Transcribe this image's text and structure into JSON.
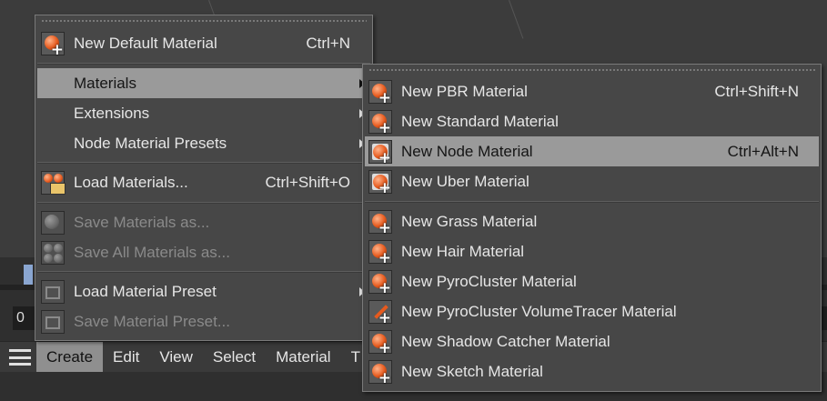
{
  "timeline": {
    "frame_value": "0"
  },
  "menubar": {
    "items": [
      {
        "label": "Create",
        "active": true
      },
      {
        "label": "Edit"
      },
      {
        "label": "View"
      },
      {
        "label": "Select"
      },
      {
        "label": "Material"
      },
      {
        "label": "T"
      }
    ]
  },
  "create_menu": {
    "items": [
      {
        "label": "New Default Material",
        "shortcut": "Ctrl+N",
        "icon": "new-material-icon"
      },
      {
        "label": "Materials",
        "submenu": true,
        "highlight": true
      },
      {
        "label": "Extensions",
        "submenu": true
      },
      {
        "label": "Node Material Presets",
        "submenu": true
      },
      {
        "label": "Load Materials...",
        "shortcut": "Ctrl+Shift+O",
        "icon": "load-materials-icon"
      },
      {
        "label": "Save Materials as...",
        "disabled": true,
        "icon": "save-materials-icon"
      },
      {
        "label": "Save All Materials as...",
        "disabled": true,
        "icon": "save-all-materials-icon"
      },
      {
        "label": "Load Material Preset",
        "submenu": true,
        "icon": "load-preset-icon"
      },
      {
        "label": "Save Material Preset...",
        "disabled": true,
        "icon": "save-preset-icon"
      }
    ]
  },
  "materials_submenu": {
    "items": [
      {
        "label": "New PBR Material",
        "shortcut": "Ctrl+Shift+N",
        "icon": "pbr-material-icon"
      },
      {
        "label": "New Standard Material",
        "icon": "standard-material-icon"
      },
      {
        "label": "New Node Material",
        "shortcut": "Ctrl+Alt+N",
        "icon": "node-material-icon",
        "highlight": true
      },
      {
        "label": "New Uber Material",
        "icon": "uber-material-icon"
      },
      {
        "label": "New Grass Material",
        "icon": "grass-material-icon"
      },
      {
        "label": "New Hair Material",
        "icon": "hair-material-icon"
      },
      {
        "label": "New PyroCluster Material",
        "icon": "pyrocluster-material-icon"
      },
      {
        "label": "New PyroCluster VolumeTracer Material",
        "icon": "pyrocluster-volumetracer-icon"
      },
      {
        "label": "New Shadow Catcher Material",
        "icon": "shadow-catcher-icon"
      },
      {
        "label": "New Sketch Material",
        "icon": "sketch-material-icon"
      }
    ]
  }
}
